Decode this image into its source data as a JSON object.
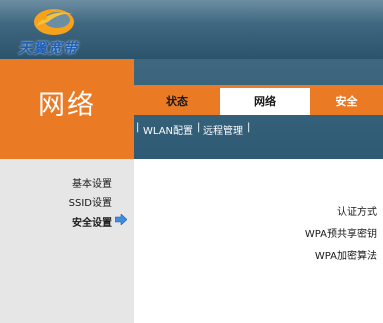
{
  "brand": {
    "name": "天翼宽带",
    "logo_icon": "tianyi-swirl-logo",
    "colors": {
      "orange": "#ea7a24",
      "header_blue": "#3f6880",
      "logo_blue": "#1f5fb5"
    }
  },
  "section": {
    "title": "网络"
  },
  "tabs": [
    {
      "label": "状态",
      "active": false
    },
    {
      "label": "网络",
      "active": true
    },
    {
      "label": "安全",
      "active": false
    }
  ],
  "subnav": {
    "separator": "|",
    "items": [
      {
        "label": "WLAN配置"
      },
      {
        "label": "远程管理"
      }
    ]
  },
  "sidebar": {
    "items": [
      {
        "label": "基本设置",
        "active": false
      },
      {
        "label": "SSID设置",
        "active": false
      },
      {
        "label": "安全设置",
        "active": true
      }
    ],
    "active_marker_icon": "arrow-right-icon"
  },
  "form": {
    "fields": [
      {
        "label": "认证方式"
      },
      {
        "label": "WPA预共享密钥"
      },
      {
        "label": "WPA加密算法"
      }
    ]
  }
}
